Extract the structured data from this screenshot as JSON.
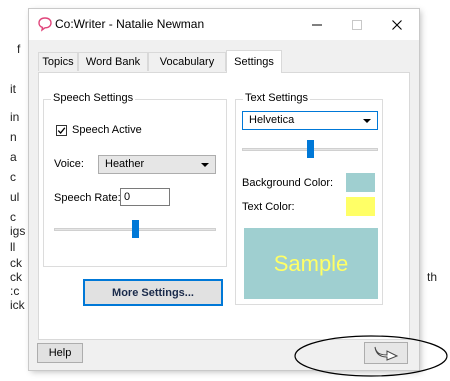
{
  "background_fragments": [
    "f",
    "it",
    "in",
    "n",
    "a",
    "c",
    "ul",
    "c",
    "igs",
    "ll",
    "ck",
    "ck",
    ":c",
    "ick",
    "th"
  ],
  "window": {
    "title": "Co:Writer - Natalie Newman",
    "controls": {
      "minimize": "—",
      "maximize": "☐",
      "close": "✕"
    }
  },
  "tabs": [
    "Topics",
    "Word Bank",
    "Vocabulary",
    "Settings"
  ],
  "active_tab": "Settings",
  "speech": {
    "group_label": "Speech Settings",
    "speech_active_label": "Speech Active",
    "speech_active_checked": true,
    "voice_label": "Voice:",
    "voice_value": "Heather",
    "rate_label": "Speech Rate:",
    "rate_value": "0",
    "slider_fraction": 0.5
  },
  "text": {
    "group_label": "Text Settings",
    "font_value": "Helvetica",
    "slider_fraction": 0.5,
    "bg_label": "Background Color:",
    "text_color_label": "Text Color:",
    "bg_color": "#9fcfd0",
    "text_color": "#ffff66",
    "sample_text": "Sample"
  },
  "buttons": {
    "more_settings": "More Settings...",
    "help": "Help"
  },
  "colors": {
    "accent": "#0078d7",
    "window_bg": "#f0f0f0",
    "panel_bg": "#ffffff"
  },
  "icons": {
    "app": "speech-bubble-icon",
    "next": "arrow-return-icon"
  }
}
